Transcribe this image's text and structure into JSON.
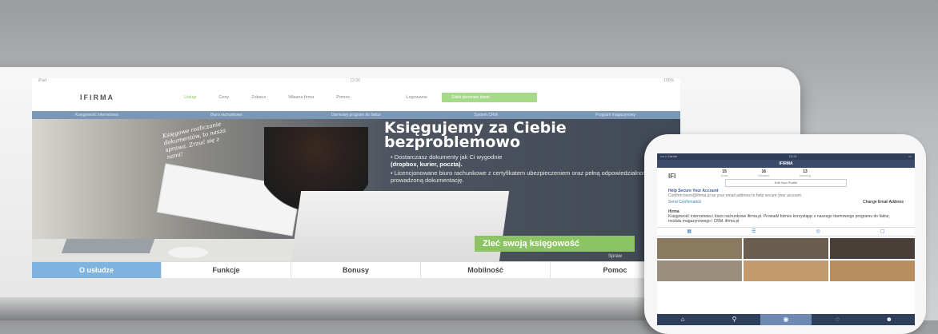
{
  "tablet": {
    "status_left": "iPad",
    "status_time": "12:00",
    "status_right": "100%",
    "logo": "IFIRMA",
    "nav": [
      "Usługi",
      "Ceny",
      "Zobacz",
      "Własna firma",
      "Pomoc"
    ],
    "login": "Logowanie",
    "cta_top": "Załóż darmowe konto",
    "subnav": [
      "Księgowość internetowa",
      "Biuro rachunkowe",
      "Darmowy program do faktur",
      "System CRM",
      "Program magazynowy"
    ],
    "handwriting": "Księgowe rozliczanie dokumentów, to nasza sprawa. Zrzuć się z nami!",
    "hero_title_1": "Księgujemy za Ciebie",
    "hero_title_2": "bezproblemowo",
    "bullet1_a": "Dostarczasz dokumenty jak Ci wygodnie",
    "bullet1_b": "(dropbox, kurier, poczta).",
    "bullet2": "Licencjonowane biuro rachunkowe z certyfikatem ubezpieczeniem oraz pełną odpowiedzialnością za prowadzoną dokumentację.",
    "hero_cta": "Zleć swoją księgowość",
    "spraw": "Spraw",
    "tabs": [
      "O usłudze",
      "Funkcje",
      "Bonusy",
      "Mobilność",
      "Pomoc"
    ]
  },
  "phone": {
    "status": "••••○ Carrier",
    "time": "13:21",
    "header": "IFIRMA",
    "logo": "IFI",
    "stats": [
      {
        "value": "15",
        "label": "posts"
      },
      {
        "value": "16",
        "label": "followers"
      },
      {
        "value": "13",
        "label": "following"
      }
    ],
    "edit_profile": "Edit Your Profile",
    "help_title": "Help Secure Your Account",
    "help_text": "Confirm biuro@ifirma.pl as your email address to help secure your account.",
    "send_confirmation": "Send Confirmation",
    "change_email": "Change Email Address",
    "bio_name": "ifirma",
    "bio_text": "Księgowość internetowa i biuro rachunkowe ifirma.pl. Prowadź biznes korzystając z naszego darmowego programu do faktur, modułu magazynowego i CRM. ifirma.pl",
    "grid_tabs": [
      "grid-icon",
      "list-icon",
      "location-icon",
      "tag-icon"
    ]
  }
}
